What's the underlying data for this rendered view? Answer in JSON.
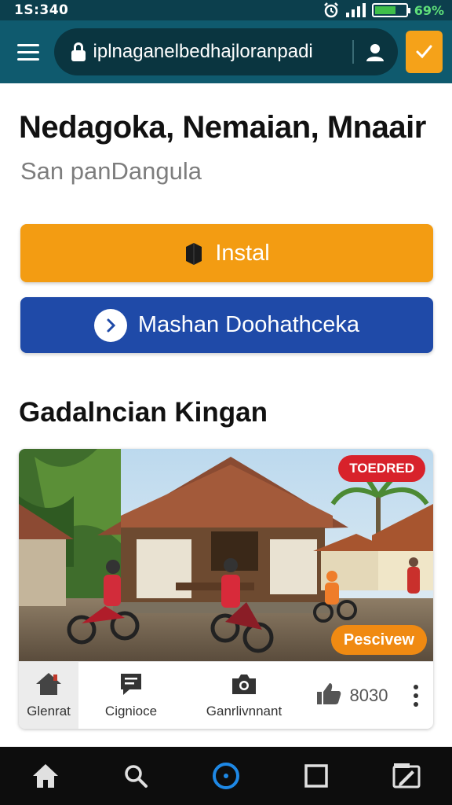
{
  "status_bar": {
    "time": "1S:340",
    "battery_percent": "69%",
    "battery_level": 0.69,
    "icons": [
      "alarm-icon",
      "signal-icon",
      "battery-icon"
    ]
  },
  "browser": {
    "url": "iplnaganelbedhajloranpadi",
    "icons": [
      "hamburger-menu-icon",
      "lock-icon",
      "profile-icon",
      "bookmark-check-icon"
    ]
  },
  "page": {
    "title": "Nedagoka, Nemaian, Mnaair",
    "subtitle": "San panDangula"
  },
  "buttons": {
    "install_label": "Instal",
    "secondary_label": "Mashan Doohathceka"
  },
  "section": {
    "title": "Gadalncian Kingan"
  },
  "card": {
    "badge": "TOEDRED",
    "preview_label": "Pescivew",
    "actions": {
      "general": "Glenrat",
      "comment": "Cignioce",
      "camera": "Ganrlivnnant",
      "like_count": "8030"
    }
  },
  "bottom_nav": {
    "items": [
      "home-icon",
      "search-icon",
      "assistant-circle-icon",
      "square-icon",
      "image-edit-icon"
    ]
  },
  "colors": {
    "status_bar": "#0c3f4d",
    "browser_bar": "#0f5a6e",
    "install_button": "#f39c12",
    "secondary_button": "#1f4aa8",
    "badge": "#d8222b",
    "preview": "#f08a12",
    "bottom_nav": "#0d0d0d"
  }
}
